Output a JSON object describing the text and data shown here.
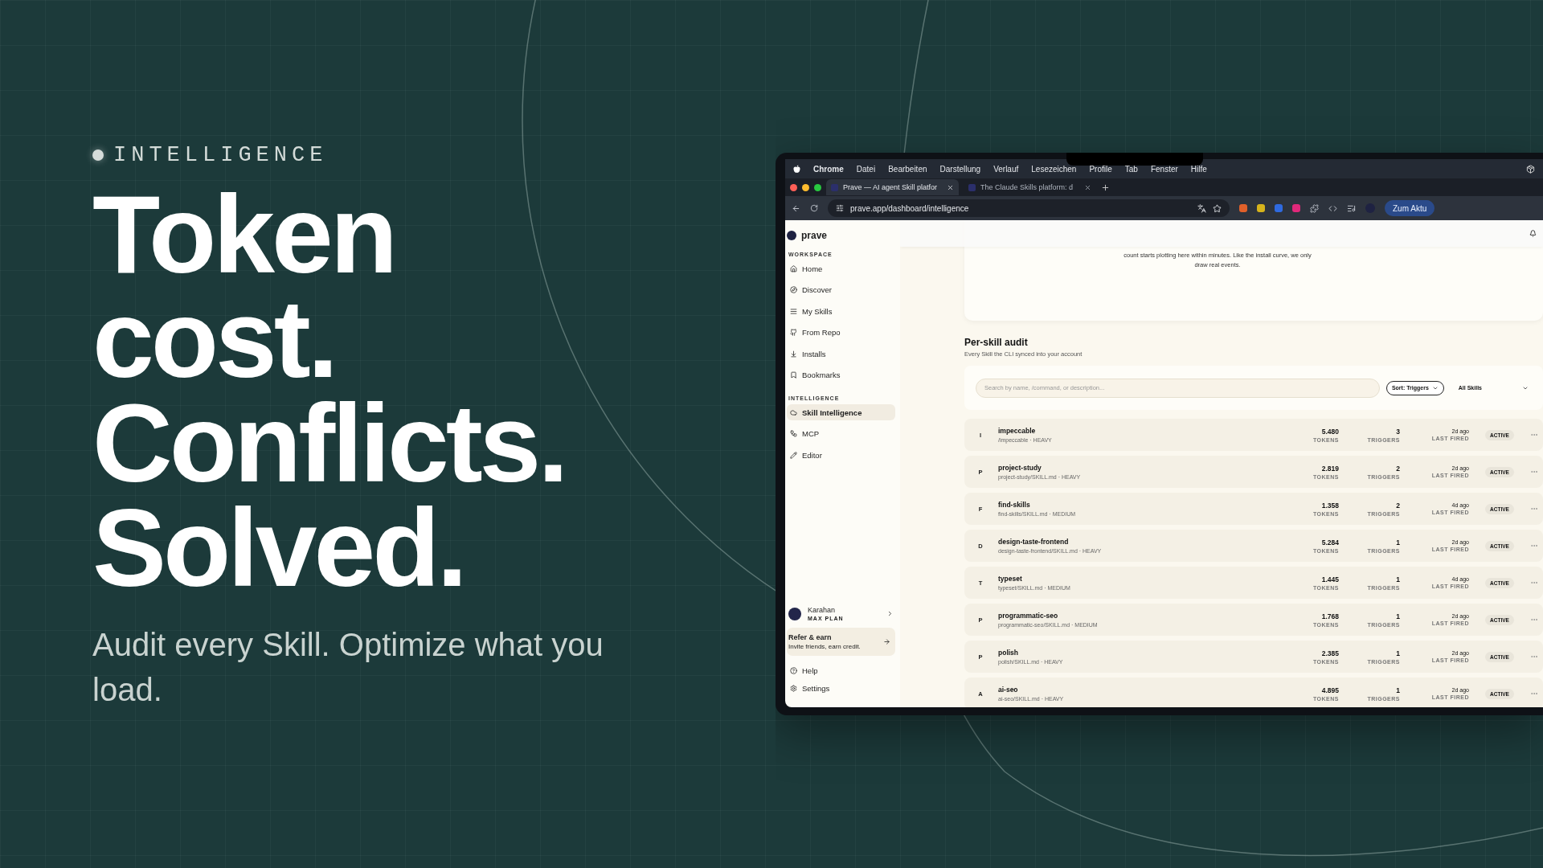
{
  "slide": {
    "eyebrow": "INTELLIGENCE",
    "headline": [
      "Token",
      "cost.",
      "Conflicts.",
      "Solved."
    ],
    "subtitle": "Audit every Skill. Optimize what you load."
  },
  "menubar": {
    "app": "Chrome",
    "items": [
      "Datei",
      "Bearbeiten",
      "Darstellung",
      "Verlauf",
      "Lesezeichen",
      "Profile",
      "Tab",
      "Fenster",
      "Hilfe"
    ]
  },
  "tabs": [
    {
      "title": "Prave — AI agent Skill platfor",
      "selected": true
    },
    {
      "title": "The Claude Skills platform: d",
      "selected": false
    }
  ],
  "address_bar": {
    "url": "prave.app/dashboard/intelligence",
    "update_button": "Zum Aktu"
  },
  "sidebar": {
    "brand": "prave",
    "sections": [
      {
        "heading": "WORKSPACE",
        "items": [
          {
            "kind": "home",
            "label": "Home",
            "selected": false
          },
          {
            "kind": "discover",
            "label": "Discover",
            "selected": false
          },
          {
            "kind": "list",
            "label": "My Skills",
            "selected": false
          },
          {
            "kind": "repo",
            "label": "From Repo",
            "selected": false
          },
          {
            "kind": "download",
            "label": "Installs",
            "selected": false
          },
          {
            "kind": "bookmark",
            "label": "Bookmarks",
            "selected": false
          }
        ]
      },
      {
        "heading": "INTELLIGENCE",
        "items": [
          {
            "kind": "intelligence",
            "label": "Skill Intelligence",
            "selected": true
          },
          {
            "kind": "mcp",
            "label": "MCP",
            "selected": false
          },
          {
            "kind": "editor",
            "label": "Editor",
            "selected": false
          }
        ]
      }
    ],
    "user": {
      "name": "Karahan",
      "plan": "MAX PLAN"
    },
    "refer": {
      "title": "Refer & earn",
      "subtitle": "Invite friends, earn credit."
    },
    "footer": [
      {
        "kind": "help",
        "label": "Help"
      },
      {
        "kind": "settings",
        "label": "Settings"
      }
    ]
  },
  "main": {
    "chart_note": "count starts plotting here within minutes. Like the install curve, we only draw real events.",
    "audit": {
      "title": "Per-skill audit",
      "subtitle": "Every Skill the CLI synced into your account",
      "search": {
        "placeholder": "Search by name, /command, or description..."
      },
      "sort": "Sort: Triggers",
      "filter": "All Skills"
    },
    "rows": [
      {
        "initial": "I",
        "name": "impeccable",
        "meta": "/impeccable · HEAVY",
        "tokens": "5.480",
        "tokens_label": "TOKENS",
        "triggers": "3",
        "triggers_label": "TRIGGERS",
        "last_fired": "2d ago",
        "last_fired_label": "LAST FIRED",
        "status": "ACTIVE"
      },
      {
        "initial": "P",
        "name": "project-study",
        "meta": "project-study/SKILL.md · HEAVY",
        "tokens": "2.819",
        "tokens_label": "TOKENS",
        "triggers": "2",
        "triggers_label": "TRIGGERS",
        "last_fired": "2d ago",
        "last_fired_label": "LAST FIRED",
        "status": "ACTIVE"
      },
      {
        "initial": "F",
        "name": "find-skills",
        "meta": "find-skills/SKILL.md · MEDIUM",
        "tokens": "1.358",
        "tokens_label": "TOKENS",
        "triggers": "2",
        "triggers_label": "TRIGGERS",
        "last_fired": "4d ago",
        "last_fired_label": "LAST FIRED",
        "status": "ACTIVE"
      },
      {
        "initial": "D",
        "name": "design-taste-frontend",
        "meta": "design-taste-frontend/SKILL.md · HEAVY",
        "tokens": "5.284",
        "tokens_label": "TOKENS",
        "triggers": "1",
        "triggers_label": "TRIGGERS",
        "last_fired": "2d ago",
        "last_fired_label": "LAST FIRED",
        "status": "ACTIVE"
      },
      {
        "initial": "T",
        "name": "typeset",
        "meta": "typeset/SKILL.md · MEDIUM",
        "tokens": "1.445",
        "tokens_label": "TOKENS",
        "triggers": "1",
        "triggers_label": "TRIGGERS",
        "last_fired": "4d ago",
        "last_fired_label": "LAST FIRED",
        "status": "ACTIVE"
      },
      {
        "initial": "P",
        "name": "programmatic-seo",
        "meta": "programmatic-seo/SKILL.md · MEDIUM",
        "tokens": "1.768",
        "tokens_label": "TOKENS",
        "triggers": "1",
        "triggers_label": "TRIGGERS",
        "last_fired": "2d ago",
        "last_fired_label": "LAST FIRED",
        "status": "ACTIVE"
      },
      {
        "initial": "P",
        "name": "polish",
        "meta": "polish/SKILL.md · HEAVY",
        "tokens": "2.385",
        "tokens_label": "TOKENS",
        "triggers": "1",
        "triggers_label": "TRIGGERS",
        "last_fired": "2d ago",
        "last_fired_label": "LAST FIRED",
        "status": "ACTIVE"
      },
      {
        "initial": "A",
        "name": "ai-seo",
        "meta": "ai-seo/SKILL.md · HEAVY",
        "tokens": "4.895",
        "tokens_label": "TOKENS",
        "triggers": "1",
        "triggers_label": "TRIGGERS",
        "last_fired": "2d ago",
        "last_fired_label": "LAST FIRED",
        "status": "ACTIVE"
      }
    ]
  }
}
